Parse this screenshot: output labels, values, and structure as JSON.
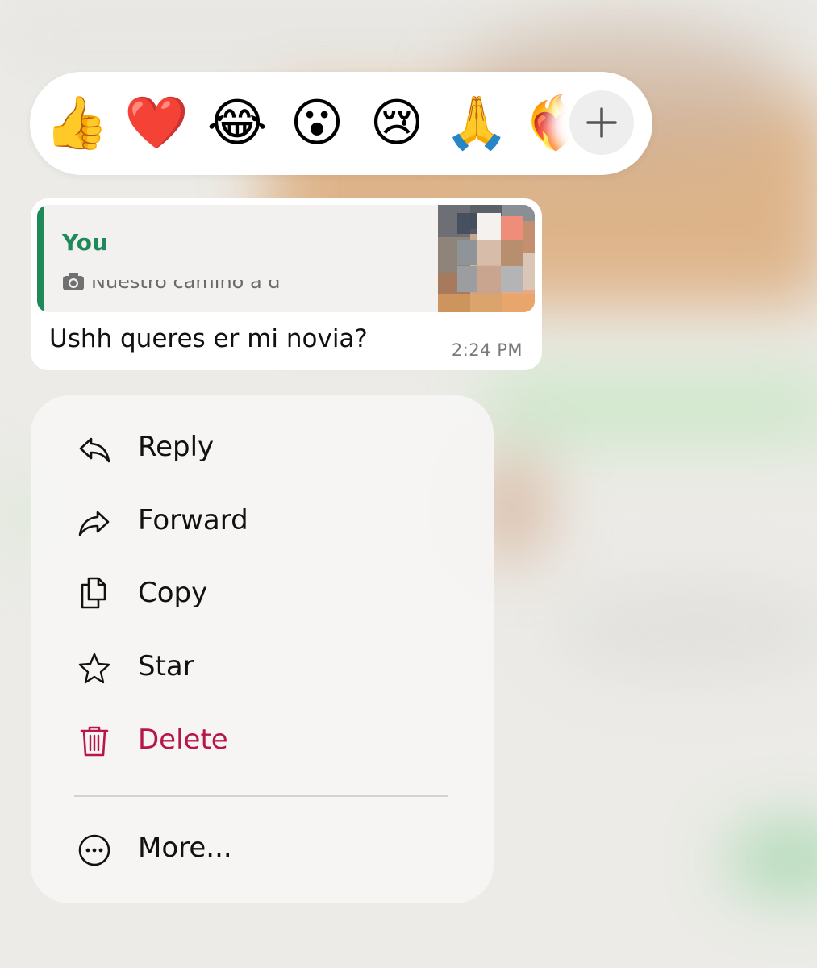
{
  "reactions": [
    {
      "emoji": "👍",
      "name": "thumbs-up"
    },
    {
      "emoji": "❤️",
      "name": "red-heart"
    },
    {
      "emoji": "😂",
      "name": "tears-of-joy"
    },
    {
      "emoji": "😮",
      "name": "open-mouth"
    },
    {
      "emoji": "😢",
      "name": "crying-face"
    },
    {
      "emoji": "🙏",
      "name": "folded-hands"
    },
    {
      "emoji": "❤️‍🔥",
      "name": "heart-on-fire"
    }
  ],
  "reaction_more": "+",
  "message": {
    "quote": {
      "author": "You",
      "text": "Nuestro camino a d"
    },
    "text": "Ushh queres er mi novia?",
    "time": "2:24 PM"
  },
  "menu": {
    "items": [
      {
        "label": "Reply",
        "icon": "reply-icon"
      },
      {
        "label": "Forward",
        "icon": "forward-icon"
      },
      {
        "label": "Copy",
        "icon": "copy-icon"
      },
      {
        "label": "Star",
        "icon": "star-icon"
      },
      {
        "label": "Delete",
        "icon": "trash-icon"
      },
      {
        "label": "More...",
        "icon": "more-icon"
      }
    ]
  },
  "colors": {
    "accent_green": "#1e8a5a",
    "danger": "#b8164a"
  }
}
